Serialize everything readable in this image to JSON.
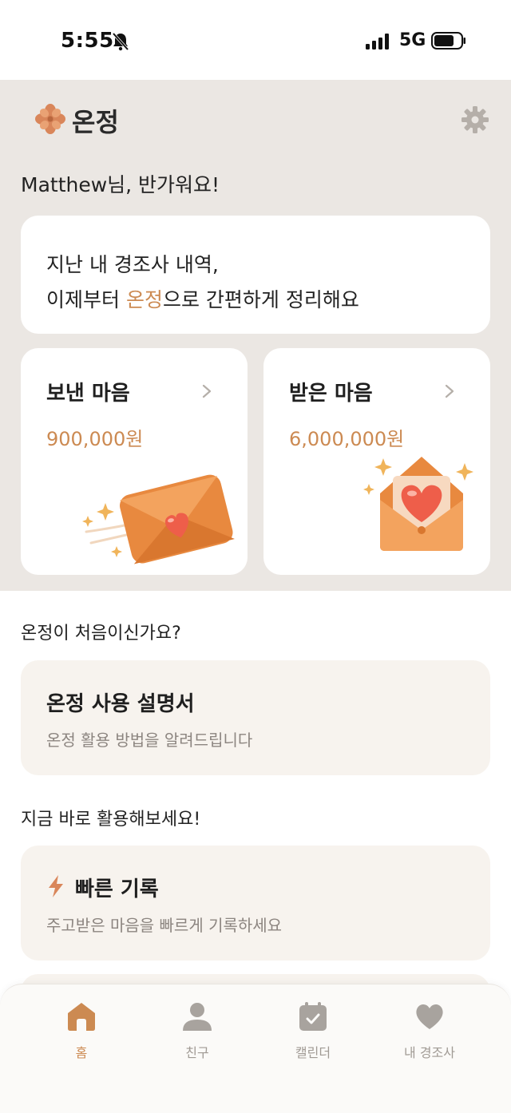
{
  "status_bar": {
    "time": "5:55",
    "network": "5G"
  },
  "header": {
    "app_name": "온정",
    "greeting": "Matthew님, 반가워요!"
  },
  "intro_card": {
    "line1": "지난 내 경조사 내역,",
    "line2_prefix": "이제부터 ",
    "line2_accent": "온정",
    "line2_suffix": "으로 간편하게 정리해요"
  },
  "summary": {
    "sent": {
      "title": "보낸 마음",
      "amount": "900,000원"
    },
    "received": {
      "title": "받은 마음",
      "amount": "6,000,000원"
    }
  },
  "guide_section": {
    "title": "온정이 처음이신가요?",
    "card_title": "온정 사용 설명서",
    "card_desc": "온정 활용 방법을 알려드립니다"
  },
  "quick_section": {
    "title": "지금 바로 활용해보세요!",
    "card_title": "빠른 기록",
    "card_desc": "주고받은 마음을 빠르게 기록하세요"
  },
  "tabs": [
    {
      "label": "홈",
      "icon": "home-icon",
      "active": true
    },
    {
      "label": "친구",
      "icon": "person-icon",
      "active": false
    },
    {
      "label": "캘린더",
      "icon": "calendar-icon",
      "active": false
    },
    {
      "label": "내 경조사",
      "icon": "heart-icon",
      "active": false
    }
  ],
  "colors": {
    "accent": "#cc8a52",
    "top_background": "#ebe7e3",
    "card_background": "#f7f3ee",
    "inactive_tab": "#a09a94"
  }
}
